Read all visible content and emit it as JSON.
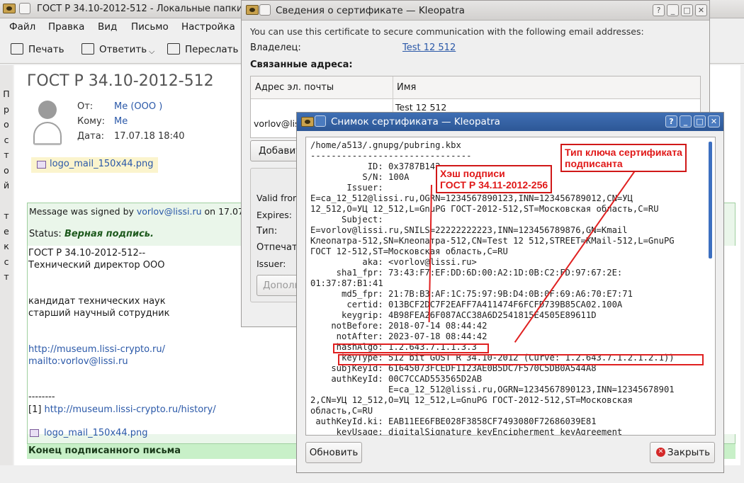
{
  "mail": {
    "title": "ГОСТ Р 34.10-2012-512 - Локальные папки",
    "menu": [
      "Файл",
      "Правка",
      "Вид",
      "Письмо",
      "Настройка"
    ],
    "toolbar": {
      "print": "Печать",
      "reply": "Ответить",
      "forward": "Переслать"
    },
    "sidebar_text": [
      "П",
      "р",
      "о",
      "с",
      "т",
      "о",
      "й",
      "",
      "т",
      "е",
      "к",
      "с",
      "т"
    ],
    "subject": "ГОСТ Р 34.10-2012-512",
    "from_label": "От:",
    "from_value": "Me (ООО  )",
    "to_label": "Кому:",
    "to_value": "Me",
    "date_label": "Дата:",
    "date_value": "17.07.18 18:40",
    "attachment": "logo_mail_150x44.png",
    "signed_prefix": "Message was signed by ",
    "signed_email": "vorlov@lissi.ru",
    "signed_suffix": " on 17.07.18",
    "status_prefix": "Status: ",
    "status_value": "Верная подпись.",
    "body": [
      "ГОСТ Р 34.10-2012-512--",
      "Технический директор ООО",
      "кандидат технических наук",
      "старший научный сотрудник"
    ],
    "links": [
      "http://museum.lissi-crypto.ru/",
      "mailto:vorlov@lissi.ru"
    ],
    "separator": "--------",
    "ref_prefix": "[1] ",
    "ref_link": "http://museum.lissi-crypto.ru/history/",
    "attachment2": "logo_mail_150x44.png",
    "end_text": "Конец подписанного письма"
  },
  "details": {
    "title": "Сведения о сертификате — Kleopatra",
    "intro": "You can use this certificate to secure communication with the following email addresses:",
    "owner_label": "Владелец:",
    "owner_value": "Test 12 512",
    "related_label": "Связанные адреса:",
    "col_email": "Адрес эл. почты",
    "col_name": "Имя",
    "row_name": "Test 12 512",
    "row_email": "vorlov@lissi.ru",
    "add_button": "Добавить",
    "fields": {
      "valid_from": "Valid from",
      "expires": "Expires:",
      "type": "Тип:",
      "fingerprint": "Отпечат",
      "issuer": "Issuer:"
    },
    "more_button": "Дополн"
  },
  "dump": {
    "title": "Снимок сертификата — Kleopatra",
    "text": "/home/a513/.gnupg/pubring.kbx\n-------------------------------\n           ID: 0x3787B142\n          S/N: 100A\n       Issuer:\nE=ca_12_512@lissi.ru,OGRN=1234567890123,INN=123456789012,CN=УЦ\n12_512,O=УЦ 12_512,L=GnuPG ГОСТ-2012-512,ST=Московская область,C=RU\n      Subject:\nE=vorlov@lissi.ru,SNILS=22222222223,INN=123456789876,GN=Kmail\nКлеопатра-512,SN=Клеопатра-512,CN=Test 12 512,STREET=KMail-512,L=GnuPG\nГОСТ 12-512,ST=Московская область,C=RU\n          aka: <vorlov@lissi.ru>\n     sha1_fpr: 73:43:F7:EF:DD:6D:00:A2:1D:0B:C2:FD:97:67:2E:\n01:37:87:B1:41\n      md5_fpr: 21:7B:B3:AF:1C:75:97:9B:D4:0B:0F:69:A6:70:E7:71\n       certid: 013BCF2DC7F2EAFF7A411474F6FCFD739B85CA02.100A\n      keygrip: 4B98FEA26F087ACC38A6D2541815E4505E89611D\n    notBefore: 2018-07-14 08:44:42\n     notAfter: 2023-07-18 08:44:42\n     hashAlgo: 1.2.643.7.1.1.3.3\n      keyType: 512 bit GOST R 34.10-2012 (Curve: 1.2.643.7.1.2.1.2.1))\n    subjKeyId: 61645073FCEDF1123AE0B5DC7F570C5DB0A544A8\n    authKeyId: 00C7CCAD553565D2AB\n               E=ca_12_512@lissi.ru,OGRN=1234567890123,INN=12345678901\n2,CN=УЦ 12_512,O=УЦ 12_512,L=GnuPG ГОСТ-2012-512,ST=Московская\nобласть,C=RU\n authKeyId.ki: EAB11EE6FBE028F3858CF7493080F72686039E81\n     keyUsage: digitalSignature keyEncipherment keyAgreement",
    "refresh_button": "Обновить",
    "close_button": "Закрыть",
    "anno_hash": "Хэш подписи\nГОСТ Р 34.11-2012-256",
    "anno_keytype": "Тип ключа сертификата\nподписанта"
  }
}
